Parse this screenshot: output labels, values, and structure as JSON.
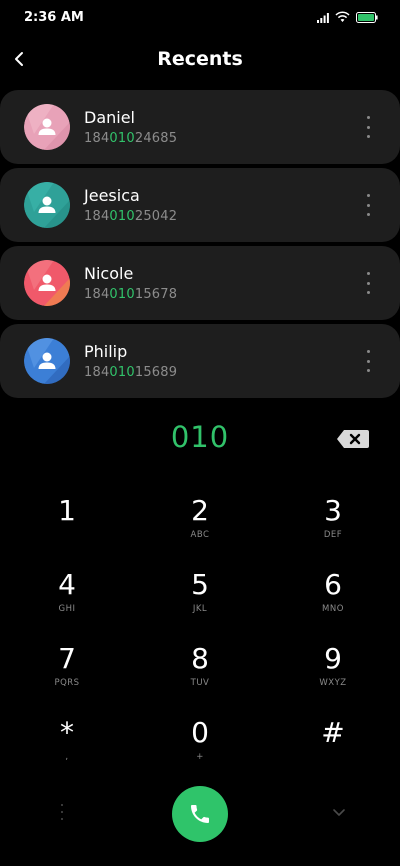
{
  "status_bar": {
    "time": "2:36 AM",
    "icons": [
      "signal-icon",
      "wifi-icon",
      "battery-icon"
    ],
    "battery_color": "#31c26a"
  },
  "header": {
    "title": "Recents",
    "back_icon": "chevron-left-icon"
  },
  "contacts": [
    {
      "name": "Daniel",
      "number_prefix": "184",
      "number_match": "010",
      "number_suffix": "24685",
      "avatar_color": "#e8a2b8"
    },
    {
      "name": "Jeesica",
      "number_prefix": "184",
      "number_match": "010",
      "number_suffix": "25042",
      "avatar_color": "#2fa198"
    },
    {
      "name": "Nicole",
      "number_prefix": "184",
      "number_match": "010",
      "number_suffix": "15678",
      "avatar_color": "#f0596a"
    },
    {
      "name": "Philip",
      "number_prefix": "184",
      "number_match": "010",
      "number_suffix": "15689",
      "avatar_color": "#3c7fd6"
    }
  ],
  "dialer": {
    "display": "010",
    "highlight_color": "#31c26a",
    "keys": [
      {
        "digit": "1",
        "letters": ""
      },
      {
        "digit": "2",
        "letters": "ABC"
      },
      {
        "digit": "3",
        "letters": "DEF"
      },
      {
        "digit": "4",
        "letters": "GHI"
      },
      {
        "digit": "5",
        "letters": "JKL"
      },
      {
        "digit": "6",
        "letters": "MNO"
      },
      {
        "digit": "7",
        "letters": "PQRS"
      },
      {
        "digit": "8",
        "letters": "TUV"
      },
      {
        "digit": "9",
        "letters": "WXYZ"
      },
      {
        "digit": "*",
        "letters": ","
      },
      {
        "digit": "0",
        "letters": "+"
      },
      {
        "digit": "#",
        "letters": ""
      }
    ]
  },
  "bottom_bar": {
    "menu_icon": "more-vertical-icon",
    "call_icon": "phone-icon",
    "call_color": "#2fc46a",
    "collapse_icon": "chevron-down-icon"
  }
}
